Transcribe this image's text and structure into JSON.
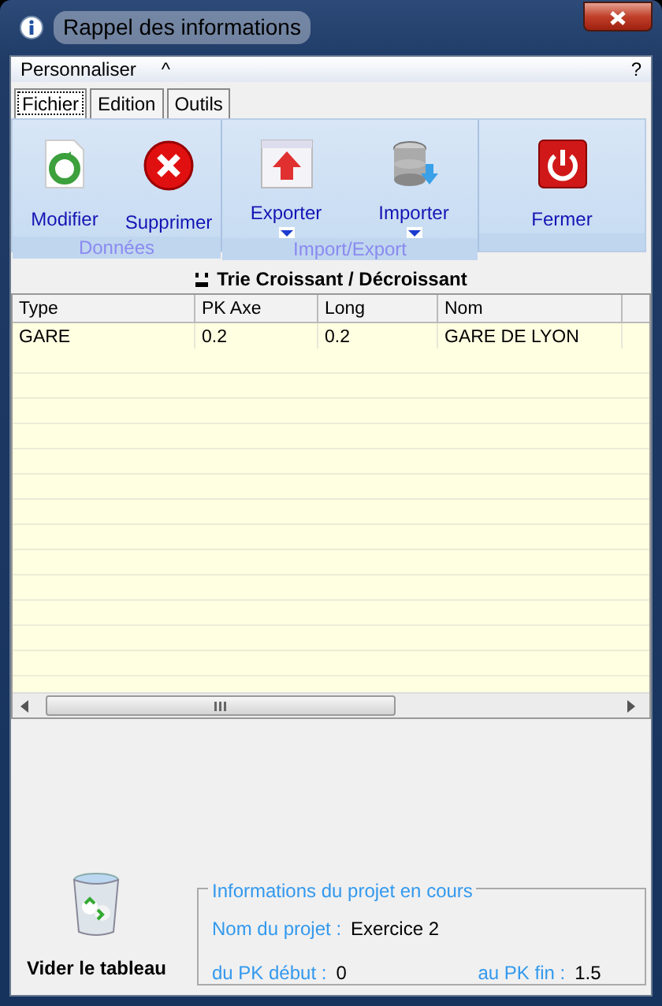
{
  "window": {
    "title": "Rappel des informations"
  },
  "menu": {
    "label": "Personnaliser",
    "collapse": "^",
    "help": "?"
  },
  "tabs": [
    {
      "label": "Fichier",
      "selected": true
    },
    {
      "label": "Edition",
      "selected": false
    },
    {
      "label": "Outils",
      "selected": false
    }
  ],
  "ribbon": [
    {
      "group": "Données",
      "buttons": [
        {
          "label": "Modifier",
          "kind": "recycle",
          "dropdown": false
        },
        {
          "label": "Supprimer",
          "kind": "delete",
          "dropdown": false
        }
      ]
    },
    {
      "group": "Import/Export",
      "buttons": [
        {
          "label": "Exporter",
          "kind": "export",
          "dropdown": true
        },
        {
          "label": "Importer",
          "kind": "import",
          "dropdown": true
        }
      ]
    },
    {
      "buttons": [
        {
          "label": "Fermer",
          "kind": "power",
          "dropdown": false
        }
      ]
    }
  ],
  "sort_label": "Trie Croissant / Décroissant",
  "table": {
    "columns": [
      "Type",
      "PK Axe",
      "Long",
      "Nom"
    ],
    "rows": [
      [
        "GARE",
        "0.2",
        "0.2",
        "GARE DE LYON"
      ]
    ]
  },
  "clear_button": {
    "label": "Vider le tableau"
  },
  "project_info": {
    "title": "Informations du projet en cours",
    "name_label": "Nom du projet :",
    "name": "Exercice 2",
    "start_label": "du PK début :",
    "start": "0",
    "end_label": "au PK fin :",
    "end": "1.5"
  }
}
